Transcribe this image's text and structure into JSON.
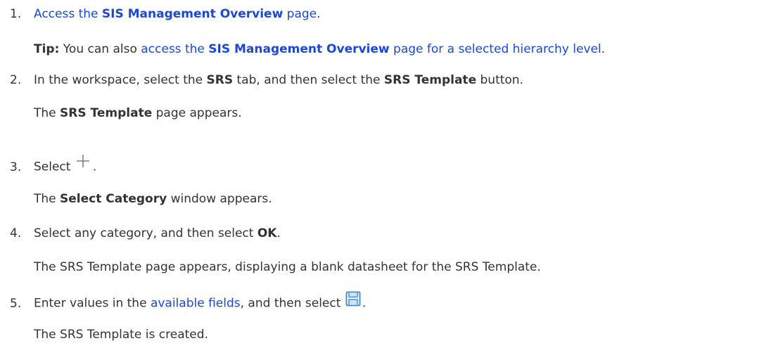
{
  "steps": [
    {
      "number": "1.",
      "link_text_pre": "Access the ",
      "link_text_bold": "SIS Management Overview",
      "link_text_post": " page",
      "after": ".",
      "tip": {
        "label": "Tip:",
        "text": " You can also ",
        "link_pre": "access the ",
        "link_bold": "SIS Management Overview",
        "link_post": " page for a selected hierarchy level",
        "after": "."
      }
    },
    {
      "number": "2.",
      "t1": "In the workspace, select the ",
      "b1": "SRS",
      "t2": " tab, and then select the ",
      "b2": "SRS Template",
      "t3": " button.",
      "result_b": "SRS Template",
      "result_t": " page appears."
    },
    {
      "number": "3.",
      "t1": "Select ",
      "icon": "plus-icon",
      "after": ".",
      "result_pre": "The ",
      "result_b": "Select Category",
      "result_t": " window appears."
    },
    {
      "number": "4.",
      "t1": "Select any category, and then select ",
      "b1": "OK",
      "after": ".",
      "result": "The SRS Template page appears, displaying a blank datasheet for the SRS Template."
    },
    {
      "number": "5.",
      "t1": "Enter values in the ",
      "link": "available fields",
      "t2": ", and then select ",
      "icon": "save-icon",
      "after": ".",
      "result": "The SRS Template is created."
    }
  ],
  "step2_result_pre": "The ",
  "colors": {
    "text": "#333333",
    "link": "#1a47e0",
    "icon": "#4a8fd6"
  }
}
